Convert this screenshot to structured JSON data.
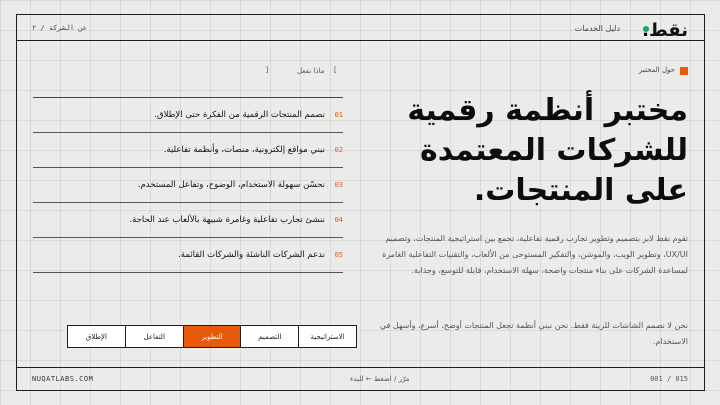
{
  "header": {
    "logo": "نقط.",
    "nav_guide": "دليل الخدمات",
    "nav_about": "عن الشركة / ٢",
    "status_color": "#1fa362"
  },
  "hero": {
    "tag": "حول المختبر",
    "headline": "مختبر أنظمة رقمية للشركات المعتمدة على المنتجات.",
    "description": "تقوم نقط لابز بتصميم وتطوير تجارب رقمية تفاعلية، تجمع بين استراتيجية المنتجات، وتصميم UX/UI، وتطوير الويب، والموشن، والتفكير المستوحى من الألعاب، والتقنيات التفاعلية الغامرة لمساعدة الشركات على بناء منتجات واضحة، سهلة الاستخدام، قابلة للتوسع، وجذابة.",
    "description2": "نحن لا نصمم الشاشات للزينة فقط. نحن نبني أنظمة تجعل المنتجات أوضح، أسرع، وأسهل في الاستخدام."
  },
  "question": {
    "bracket_open": "[",
    "text": "ماذا نفعل",
    "bracket_close": "]"
  },
  "features": [
    {
      "num": "01",
      "text": "نصمم المنتجات الرقمية من الفكرة حتى الإطلاق."
    },
    {
      "num": "02",
      "text": "نبني مواقع إلكترونية، منصات، وأنظمة تفاعلية."
    },
    {
      "num": "03",
      "text": "نحسّن سهولة الاستخدام، الوضوح، وتفاعل المستخدم."
    },
    {
      "num": "04",
      "text": "ننشئ تجارب تفاعلية وغامرة شبيهة بالألعاب عند الحاجة."
    },
    {
      "num": "05",
      "text": "ندعم الشركات الناشئة والشركات القائمة."
    }
  ],
  "tabs": [
    {
      "label": "الاستراتيجية",
      "active": false
    },
    {
      "label": "التصميم",
      "active": false
    },
    {
      "label": "التطوير",
      "active": true
    },
    {
      "label": "التفاعل",
      "active": false
    },
    {
      "label": "الإطلاق",
      "active": false
    }
  ],
  "footer": {
    "site": "NUQATLABS.COM",
    "hint": "مرّر / اضغط ← للبدء",
    "page": "001 / 015"
  },
  "colors": {
    "accent": "#e8590c",
    "background": "#ebebea",
    "ink": "#111111"
  }
}
